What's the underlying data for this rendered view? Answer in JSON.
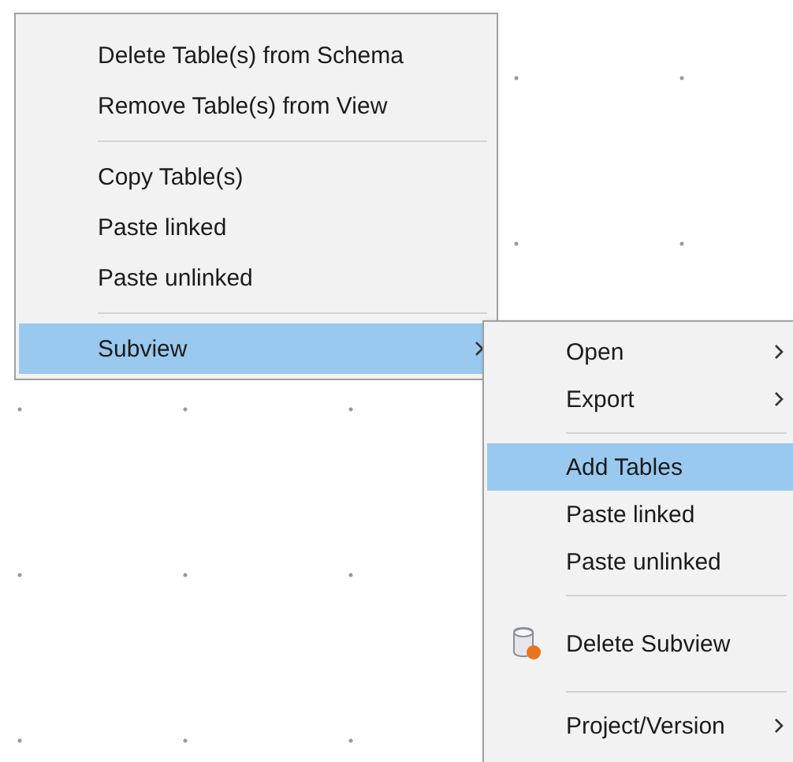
{
  "context_menu": {
    "items": [
      {
        "kind": "item",
        "label": "Delete Table(s) from Schema",
        "selected": false,
        "has_submenu": false
      },
      {
        "kind": "item",
        "label": "Remove Table(s) from View",
        "selected": false,
        "has_submenu": false
      },
      {
        "kind": "separator"
      },
      {
        "kind": "item",
        "label": "Copy Table(s)",
        "selected": false,
        "has_submenu": false
      },
      {
        "kind": "item",
        "label": "Paste linked",
        "selected": false,
        "has_submenu": false
      },
      {
        "kind": "item",
        "label": "Paste unlinked",
        "selected": false,
        "has_submenu": false
      },
      {
        "kind": "separator"
      },
      {
        "kind": "item",
        "label": "Subview",
        "selected": true,
        "has_submenu": true
      }
    ]
  },
  "submenu": {
    "items": [
      {
        "kind": "item",
        "label": "Open",
        "selected": false,
        "has_submenu": true
      },
      {
        "kind": "item",
        "label": "Export",
        "selected": false,
        "has_submenu": true
      },
      {
        "kind": "separator"
      },
      {
        "kind": "item",
        "label": "Add Tables",
        "selected": true,
        "has_submenu": false
      },
      {
        "kind": "item",
        "label": "Paste linked",
        "selected": false,
        "has_submenu": false
      },
      {
        "kind": "item",
        "label": "Paste unlinked",
        "selected": false,
        "has_submenu": false
      },
      {
        "kind": "separator"
      },
      {
        "kind": "icon_item",
        "label": "Delete Subview",
        "selected": false,
        "has_submenu": false
      },
      {
        "kind": "separator"
      },
      {
        "kind": "item",
        "label": "Project/Version",
        "selected": false,
        "has_submenu": true
      }
    ]
  }
}
